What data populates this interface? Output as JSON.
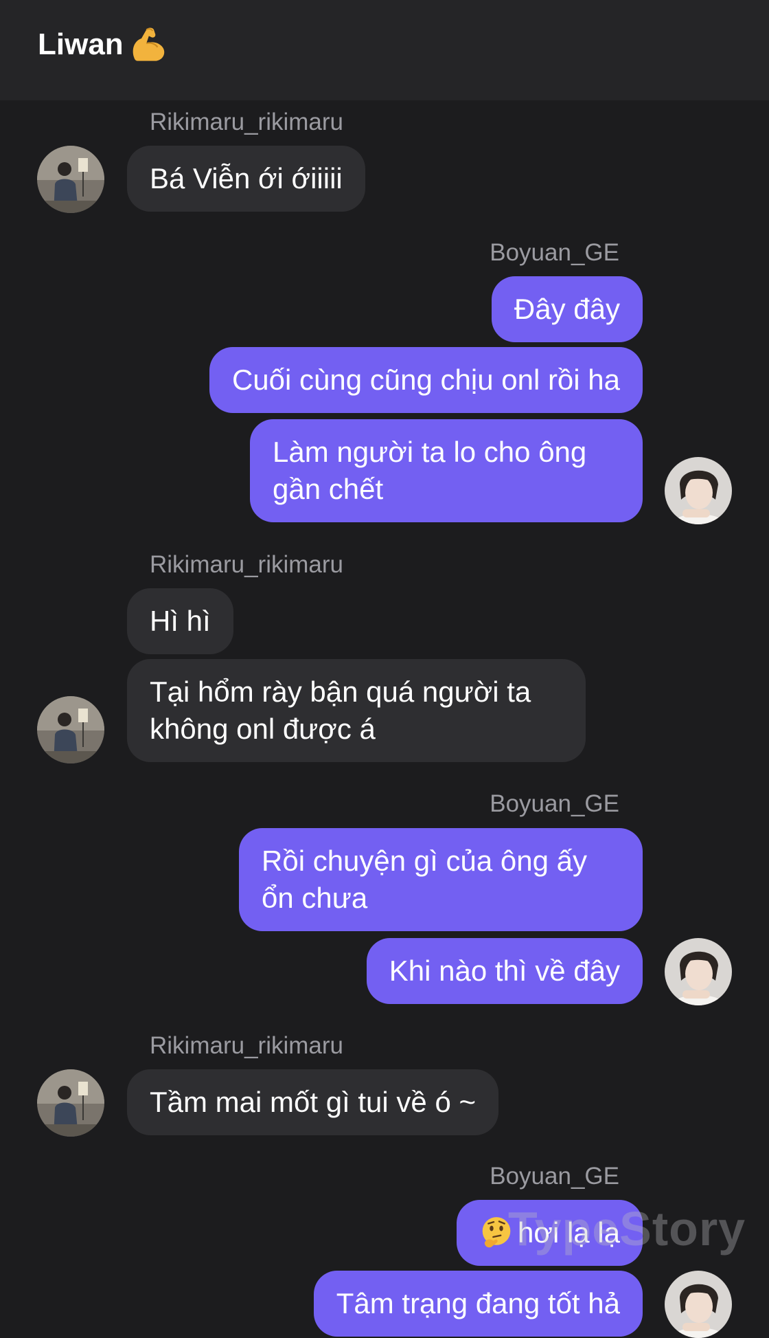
{
  "header": {
    "title": "Liwan",
    "emoji_icon": "flexed-biceps-icon"
  },
  "messages": {
    "m1": {
      "sender": "Rikimaru_rikimaru",
      "text": "Bá Viễn ới ớiiiii"
    },
    "m2": {
      "sender": "Boyuan_GE",
      "text": "Đây đây"
    },
    "m3": {
      "text": "Cuối cùng cũng chịu onl rồi ha"
    },
    "m4": {
      "text": "Làm người ta lo cho ông gần chết"
    },
    "m5": {
      "sender": "Rikimaru_rikimaru",
      "text": "Hì hì"
    },
    "m6": {
      "text": "Tại hổm rày bận quá người ta không onl được á"
    },
    "m7": {
      "sender": "Boyuan_GE",
      "text": "Rồi chuyện gì của ông ấy ổn chưa"
    },
    "m8": {
      "text": "Khi nào thì về đây"
    },
    "m9": {
      "sender": "Rikimaru_rikimaru",
      "text": "Tầm mai mốt gì tui về ó ~"
    },
    "m10": {
      "sender": "Boyuan_GE",
      "emoji_icon": "thinking-face-icon",
      "text": "hơi lạ lạ"
    },
    "m11": {
      "text": "Tâm trạng đang tốt hả"
    }
  },
  "watermark": "TypeStory",
  "colors": {
    "background": "#1c1c1e",
    "header": "#252527",
    "incoming_bubble": "#2e2e31",
    "outgoing_bubble": "#7360f2",
    "sender_name": "#9b9ba1"
  }
}
